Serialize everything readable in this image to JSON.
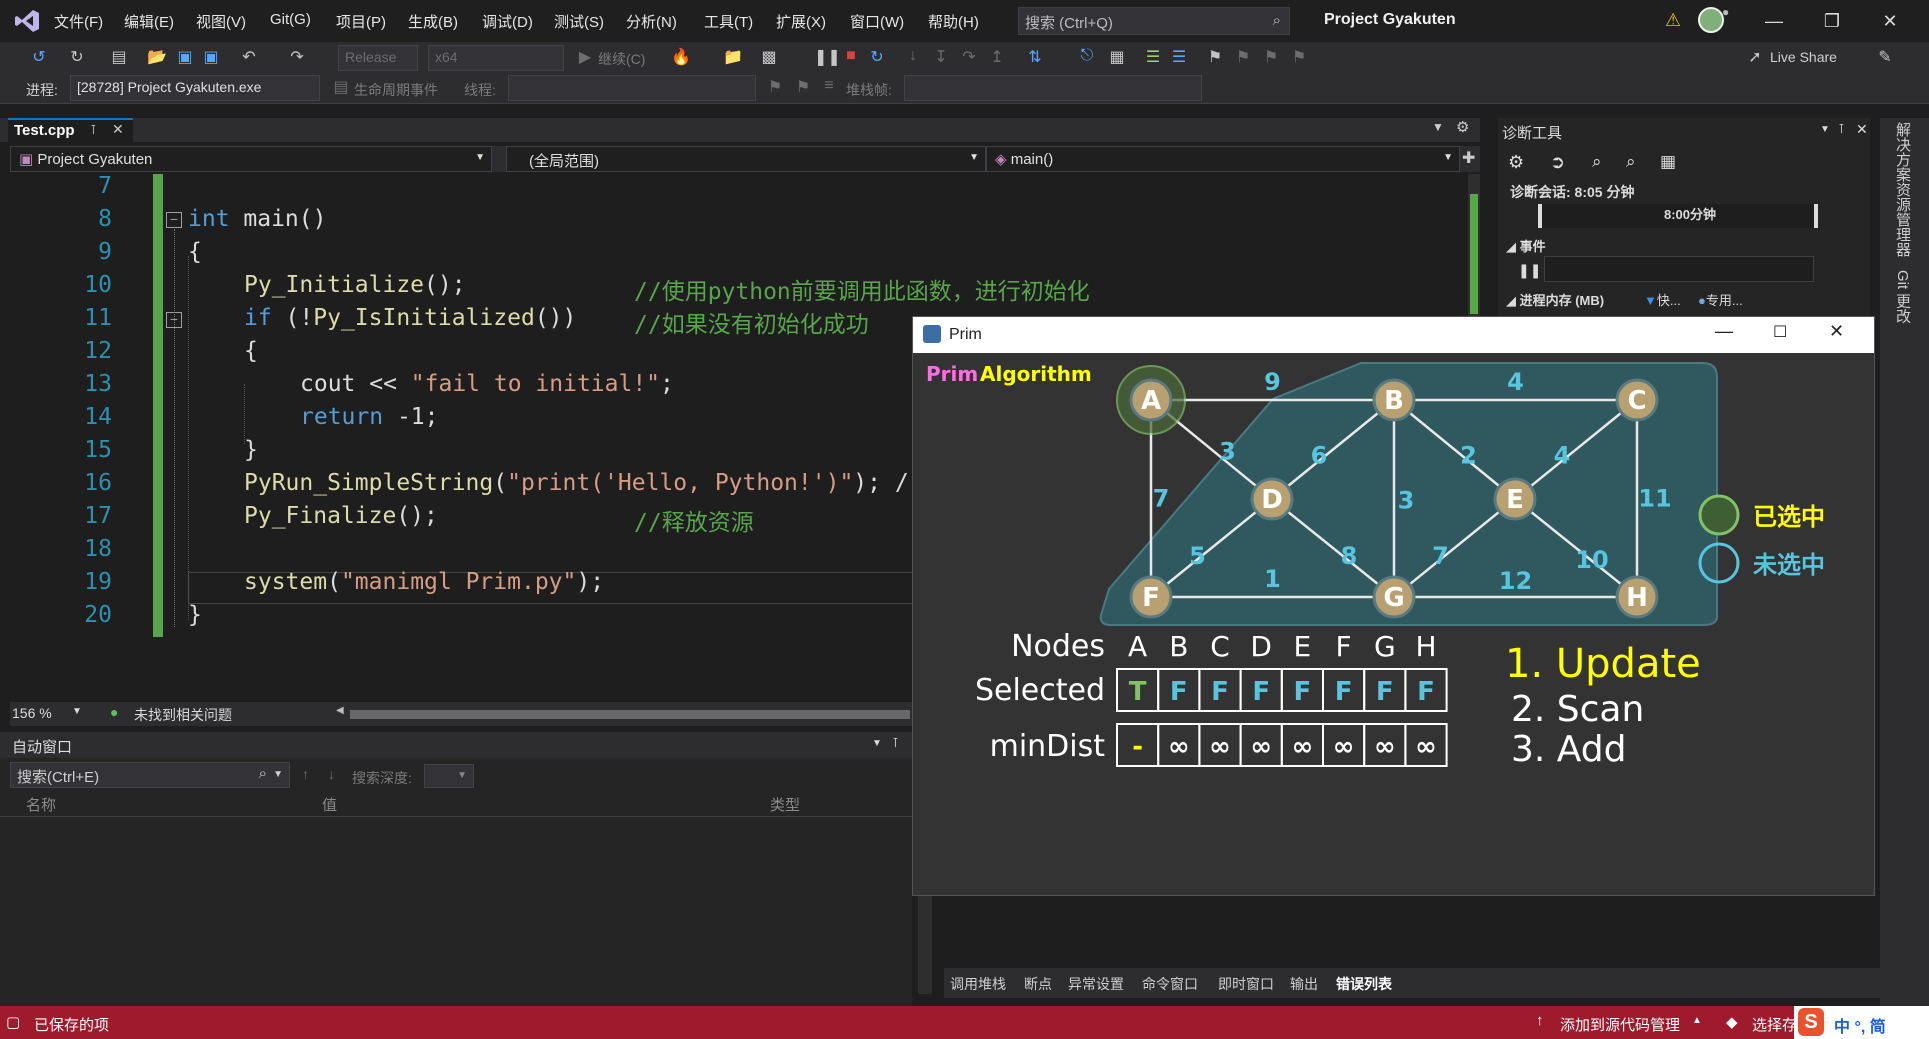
{
  "menu": {
    "items": [
      "文件(F)",
      "编辑(E)",
      "视图(V)",
      "Git(G)",
      "项目(P)",
      "生成(B)",
      "调试(D)",
      "测试(S)",
      "分析(N)",
      "工具(T)",
      "扩展(X)",
      "窗口(W)",
      "帮助(H)"
    ],
    "search_placeholder": "搜索 (Ctrl+Q)",
    "project_title": "Project Gyakuten"
  },
  "toolbar": {
    "config": "Release",
    "platform": "x64",
    "continue_label": "继续(C)",
    "live_share": "Live Share",
    "process_label": "进程:",
    "process_value": "[28728] Project Gyakuten.exe",
    "lifecycle_label": "生命周期事件",
    "thread_label": "线程:",
    "stackframe_label": "堆栈帧:"
  },
  "editor": {
    "tab_name": "Test.cpp",
    "project_combo": "Project Gyakuten",
    "scope_combo": "(全局范围)",
    "member_combo": "main()",
    "zoom": "156 %",
    "issues": "未找到相关问题",
    "lines": [
      {
        "num": "7"
      },
      {
        "num": "8"
      },
      {
        "num": "9"
      },
      {
        "num": "10"
      },
      {
        "num": "11"
      },
      {
        "num": "12"
      },
      {
        "num": "13"
      },
      {
        "num": "14"
      },
      {
        "num": "15"
      },
      {
        "num": "16"
      },
      {
        "num": "17"
      },
      {
        "num": "18"
      },
      {
        "num": "19"
      },
      {
        "num": "20"
      }
    ],
    "code": {
      "l8_kw": "int",
      "l8_rest": " main()",
      "l9": "{",
      "l10_fn": "Py_Initialize",
      "l10_rest": "();",
      "l10_cm": "//使用python前要调用此函数，进行初始化",
      "l11_kw": "if",
      "l11_rest": " (!",
      "l11_fn": "Py_IsInitialized",
      "l11_rest2": "())",
      "l11_cm": "//如果没有初始化成功",
      "l12": "{",
      "l13_a": "cout << ",
      "l13_str": "\"fail to initial!\"",
      "l13_b": ";",
      "l14_kw": "return",
      "l14_rest": " -1;",
      "l15": "}",
      "l16_fn": "PyRun_SimpleString",
      "l16_a": "(",
      "l16_str": "\"print('Hello, Python!')\"",
      "l16_b": "); /",
      "l17_fn": "Py_Finalize",
      "l17_rest": "();",
      "l17_cm": "//释放资源",
      "l19_fn": "system",
      "l19_a": "(",
      "l19_str": "\"manimgl Prim.py\"",
      "l19_b": ");",
      "l20": "}"
    }
  },
  "auto_window": {
    "title": "自动窗口",
    "search": "搜索(Ctrl+E)",
    "depth_label": "搜索深度:",
    "col_name": "名称",
    "col_value": "值",
    "col_type": "类型"
  },
  "diagnostics": {
    "title": "诊断工具",
    "session": "诊断会话: 8:05 分钟",
    "timeline": "8:00分钟",
    "events": "事件",
    "memory": "进程内存 (MB)",
    "legend_fast": "快...",
    "legend_private": "专用..."
  },
  "rail": {
    "solution": "解决方案资源管理器",
    "git": "Git 更改"
  },
  "bottom_tabs": [
    "调用堆栈",
    "断点",
    "异常设置",
    "命令窗口",
    "即时窗口",
    "输出",
    "错误列表"
  ],
  "statusbar": {
    "saved": "已保存的项",
    "source_control": "添加到源代码管理",
    "select_repo": "选择存",
    "ime": "中 °, 简"
  },
  "prim": {
    "window_title": "Prim",
    "title_word1": "Prim",
    "title_word2": "Algorithm",
    "nodes": [
      "A",
      "B",
      "C",
      "D",
      "E",
      "F",
      "G",
      "H"
    ],
    "edges": [
      {
        "from": "A",
        "to": "B",
        "w": "9"
      },
      {
        "from": "B",
        "to": "C",
        "w": "4"
      },
      {
        "from": "A",
        "to": "D",
        "w": "3"
      },
      {
        "from": "B",
        "to": "D",
        "w": "6"
      },
      {
        "from": "B",
        "to": "E",
        "w": "2"
      },
      {
        "from": "C",
        "to": "E",
        "w": "4"
      },
      {
        "from": "A",
        "to": "F",
        "w": "7"
      },
      {
        "from": "B",
        "to": "G",
        "w": "3"
      },
      {
        "from": "C",
        "to": "H",
        "w": "11"
      },
      {
        "from": "D",
        "to": "F",
        "w": "5"
      },
      {
        "from": "D",
        "to": "G",
        "w": "8"
      },
      {
        "from": "E",
        "to": "G",
        "w": "7"
      },
      {
        "from": "E",
        "to": "H",
        "w": "10"
      },
      {
        "from": "F",
        "to": "G",
        "w": "1"
      },
      {
        "from": "G",
        "to": "H",
        "w": "12"
      }
    ],
    "legend_selected": "已选中",
    "legend_unselected": "未选中",
    "row_nodes": "Nodes",
    "row_selected": "Selected",
    "row_mindist": "minDist",
    "selected": [
      "T",
      "F",
      "F",
      "F",
      "F",
      "F",
      "F",
      "F"
    ],
    "mindist": [
      "-",
      "∞",
      "∞",
      "∞",
      "∞",
      "∞",
      "∞",
      "∞"
    ],
    "steps": [
      "1. Update",
      "2. Scan",
      "3. Add"
    ],
    "colors": {
      "node_fill": "#b8a070",
      "node_stroke": "#5a7a80",
      "edge": "#e8e8e8",
      "weight": "#58c4dd",
      "selected_ring": "#83c167",
      "unselected_ring": "#58c4dd",
      "title_pink": "#fc6ee6",
      "title_yellow": "#ffff00"
    }
  }
}
